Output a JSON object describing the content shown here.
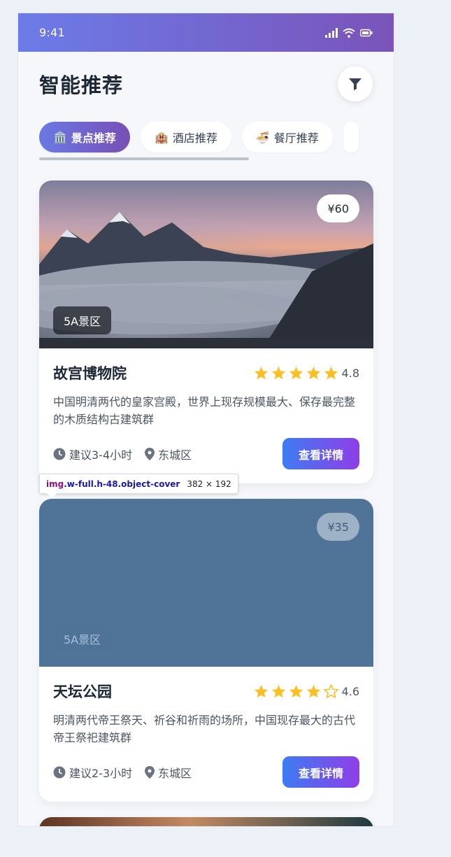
{
  "status_bar": {
    "time": "9:41"
  },
  "header": {
    "title": "智能推荐"
  },
  "tabs": [
    {
      "icon": "🏛️",
      "label": "景点推荐",
      "active": true
    },
    {
      "icon": "🏨",
      "label": "酒店推荐",
      "active": false
    },
    {
      "icon": "🍜",
      "label": "餐厅推荐",
      "active": false
    }
  ],
  "cards": [
    {
      "title": "故宫博物院",
      "price": "¥60",
      "level": "5A景区",
      "rating": 4.8,
      "rating_text": "4.8",
      "stars": [
        1,
        1,
        1,
        1,
        1
      ],
      "description": "中国明清两代的皇家宫殿，世界上现存规模最大、保存最完整的木质结构古建筑群",
      "duration": "建议3-4小时",
      "district": "东城区",
      "button": "查看详情"
    },
    {
      "title": "天坛公园",
      "price": "¥35",
      "level": "5A景区",
      "rating": 4.6,
      "rating_text": "4.6",
      "stars": [
        1,
        1,
        1,
        1,
        0
      ],
      "description": "明清两代帝王祭天、祈谷和祈雨的场所，中国现存最大的古代帝王祭祀建筑群",
      "duration": "建议2-3小时",
      "district": "东城区",
      "button": "查看详情"
    }
  ],
  "devtools_tooltip": {
    "tag": "img",
    "classes": ".w-full.h-48.object-cover",
    "size": "382 × 192"
  },
  "colors": {
    "accent_start": "#6c7be8",
    "accent_end": "#7a54b9",
    "button_start": "#3d7cf2",
    "button_end": "#8f3ee8",
    "star": "#fbbf24"
  }
}
